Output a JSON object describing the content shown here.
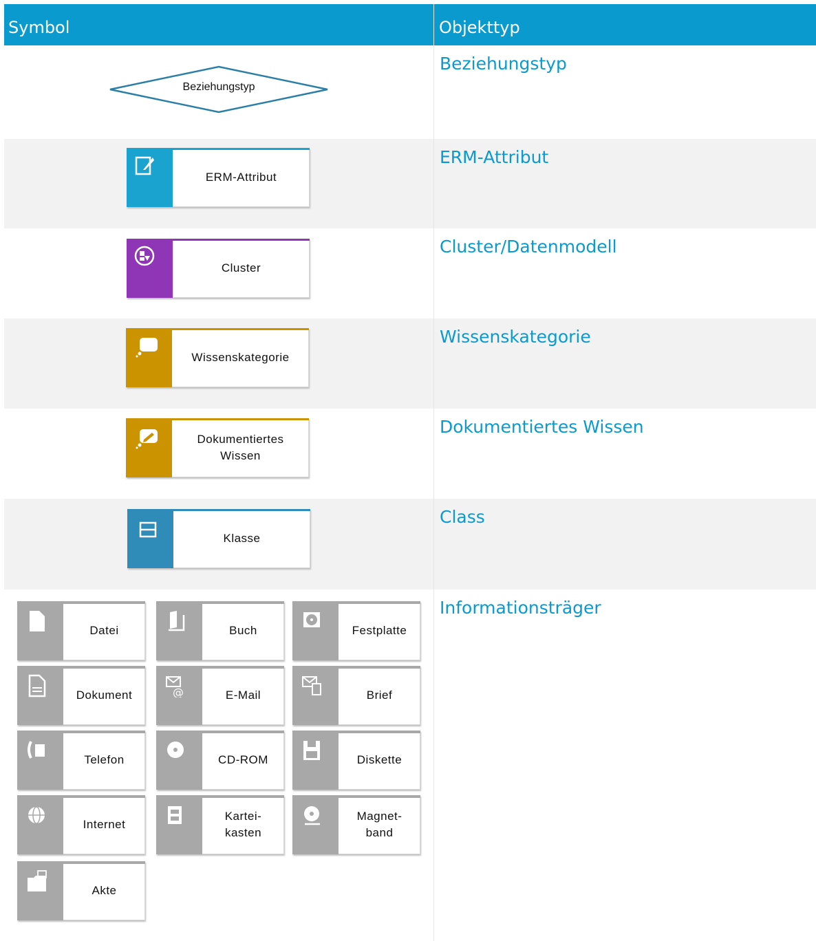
{
  "header": {
    "col_symbol": "Symbol",
    "col_type": "Objekttyp"
  },
  "rows": [
    {
      "type": "Beziehungstyp",
      "symbol_label": "Beziehungstyp"
    },
    {
      "type": "ERM-Attribut",
      "symbol_label": "ERM-Attribut",
      "color": "#1aa3cf"
    },
    {
      "type": "Cluster/Datenmodell",
      "symbol_label": "Cluster",
      "color": "#8e36b5"
    },
    {
      "type": "Wissenskategorie",
      "symbol_label": "Wissenskategorie",
      "color": "#cc9300"
    },
    {
      "type": "Dokumentiertes Wissen",
      "symbol_label": "Dokumentiertes\nWissen",
      "color": "#cc9300"
    },
    {
      "type": "Class",
      "symbol_label": "Klasse",
      "color": "#2f8bb8"
    },
    {
      "type": "Informationsträger"
    }
  ],
  "info_carriers": [
    {
      "label": "Datei",
      "icon": "file-icon"
    },
    {
      "label": "Buch",
      "icon": "book-icon"
    },
    {
      "label": "Festplatte",
      "icon": "harddisk-icon"
    },
    {
      "label": "Dokument",
      "icon": "document-icon"
    },
    {
      "label": "E-Mail",
      "icon": "email-icon"
    },
    {
      "label": "Brief",
      "icon": "letter-icon"
    },
    {
      "label": "Telefon",
      "icon": "phone-icon"
    },
    {
      "label": "CD-ROM",
      "icon": "cd-icon"
    },
    {
      "label": "Diskette",
      "icon": "floppy-icon"
    },
    {
      "label": "Internet",
      "icon": "globe-icon"
    },
    {
      "label": "Kartei-\nkasten",
      "icon": "card-index-icon"
    },
    {
      "label": "Magnet-\nband",
      "icon": "tape-icon"
    },
    {
      "label": "Akte",
      "icon": "folder-icon"
    }
  ],
  "colors": {
    "header": "#0a9acd",
    "link": "#0a9acd",
    "carrier_stripe": "#a8a8a8"
  }
}
